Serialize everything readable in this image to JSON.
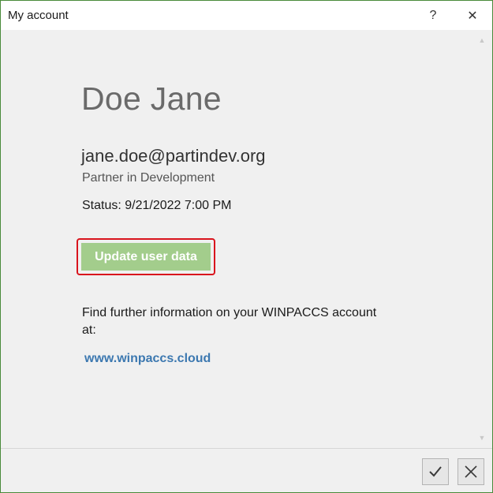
{
  "window": {
    "title": "My account",
    "help_glyph": "?",
    "close_glyph": "✕"
  },
  "scroll": {
    "up_glyph": "▲",
    "down_glyph": "▼"
  },
  "user": {
    "name": "Doe Jane",
    "email": "jane.doe@partindev.org",
    "organization": "Partner in Development",
    "status": "Status: 9/21/2022 7:00 PM"
  },
  "actions": {
    "update_label": "Update user data"
  },
  "info": {
    "text": "Find further information on your WINPACCS account at:",
    "link_text": "www.winpaccs.cloud"
  },
  "footer": {
    "ok_icon": "checkmark-icon",
    "cancel_icon": "close-icon"
  },
  "colors": {
    "accent_green": "#a3cd8c",
    "highlight_red": "#d9141d",
    "link_blue": "#3c78b0",
    "window_border": "#4a8a3a"
  }
}
